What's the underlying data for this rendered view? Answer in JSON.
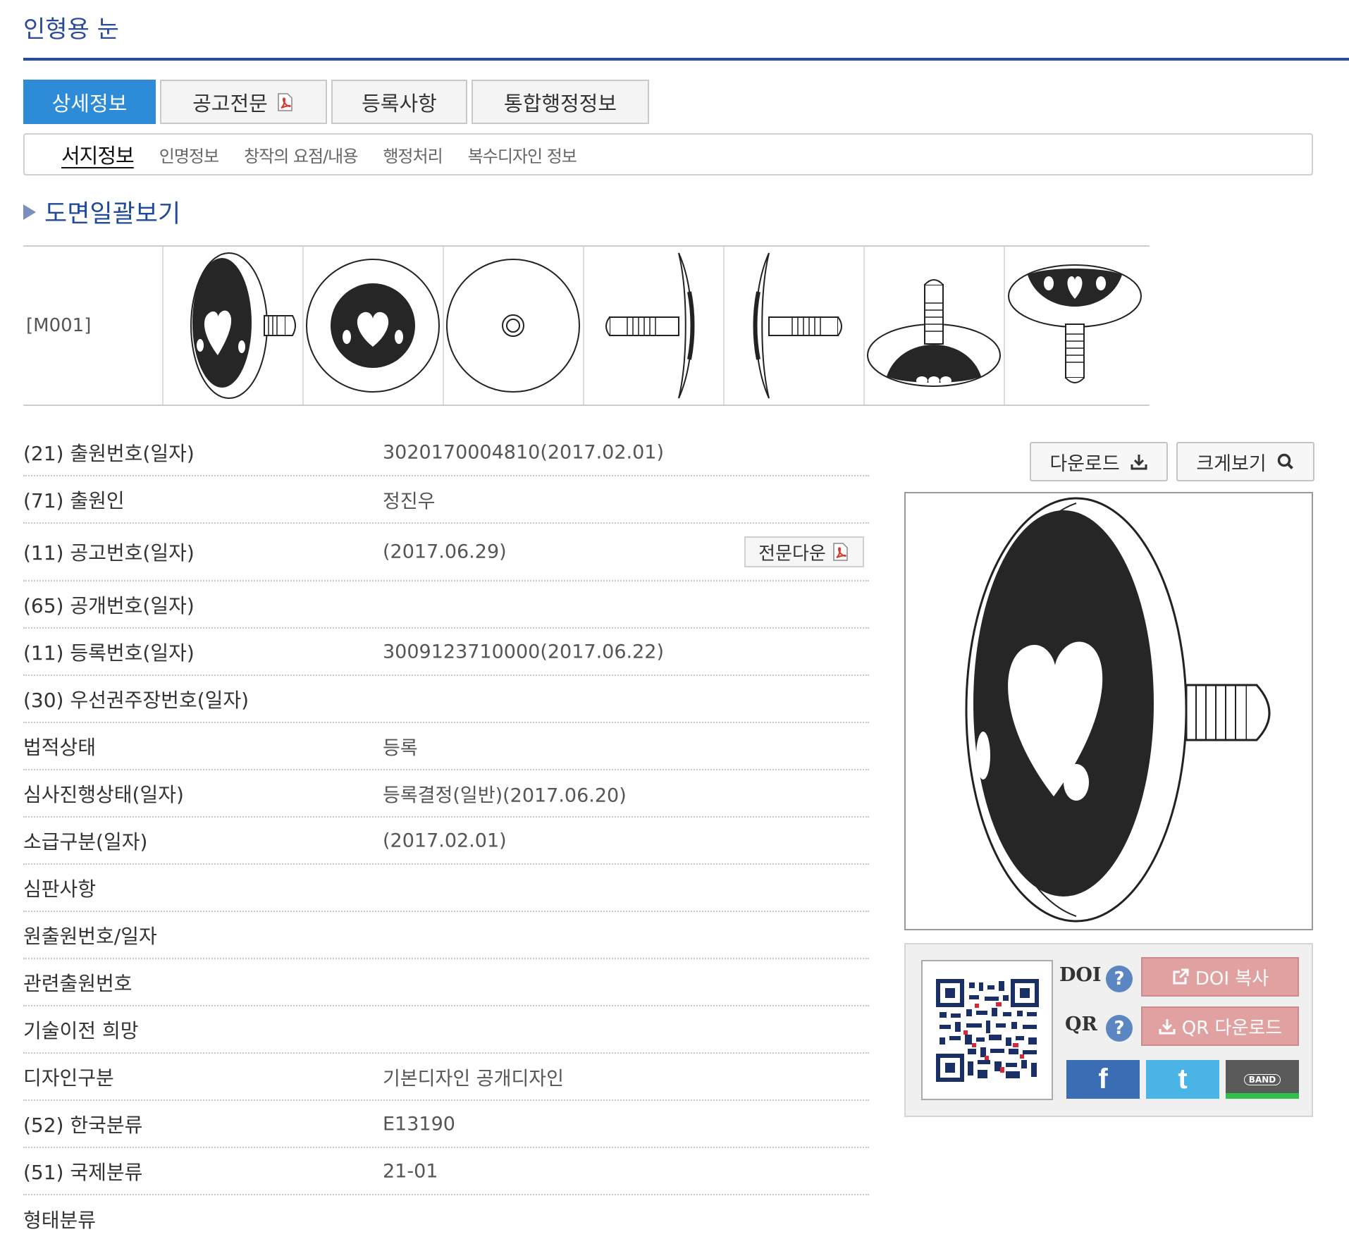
{
  "page_title": "인형용 눈",
  "tabs": [
    {
      "label": "상세정보"
    },
    {
      "label": "공고전문"
    },
    {
      "label": "등록사항"
    },
    {
      "label": "통합행정정보"
    }
  ],
  "subnav": [
    "서지정보",
    "인명정보",
    "창작의 요점/내용",
    "행정처리",
    "복수디자인 정보"
  ],
  "drawings": {
    "heading": "도면일괄보기",
    "code": "[M001]"
  },
  "info_rows": [
    {
      "label": "(21) 출원번호(일자)",
      "value": "3020170004810(2017.02.01)"
    },
    {
      "label": "(71) 출원인",
      "value": "정진우"
    },
    {
      "label": "(11) 공고번호(일자)",
      "value": "(2017.06.29)",
      "button": "전문다운"
    },
    {
      "label": "(65) 공개번호(일자)",
      "value": ""
    },
    {
      "label": "(11) 등록번호(일자)",
      "value": "3009123710000(2017.06.22)"
    },
    {
      "label": "(30) 우선권주장번호(일자)",
      "value": ""
    },
    {
      "label": "법적상태",
      "value": "등록"
    },
    {
      "label": "심사진행상태(일자)",
      "value": "등록결정(일반)(2017.06.20)"
    },
    {
      "label": "소급구분(일자)",
      "value": "(2017.02.01)"
    },
    {
      "label": "심판사항",
      "value": ""
    },
    {
      "label": "원출원번호/일자",
      "value": ""
    },
    {
      "label": "관련출원번호",
      "value": ""
    },
    {
      "label": "기술이전 희망",
      "value": ""
    },
    {
      "label": "디자인구분",
      "value": "기본디자인 공개디자인"
    },
    {
      "label": "(52) 한국분류",
      "value": "E13190"
    },
    {
      "label": "(51) 국제분류",
      "value": "21-01"
    },
    {
      "label": "형태분류",
      "value": ""
    }
  ],
  "buttons": {
    "download": "다운로드",
    "zoom": "크게보기"
  },
  "share": {
    "doi_label": "DOI",
    "qr_label": "QR",
    "doi_copy": "DOI 복사",
    "qr_download": "QR 다운로드",
    "band": "BAND",
    "colors": {
      "pink": "#e2a1a1",
      "facebook": "#3b6db4",
      "twitter": "#4ab4e6",
      "band": "#5a5a5a"
    }
  },
  "accent_color": "#2d8bd7",
  "title_color": "#2b4a9c"
}
